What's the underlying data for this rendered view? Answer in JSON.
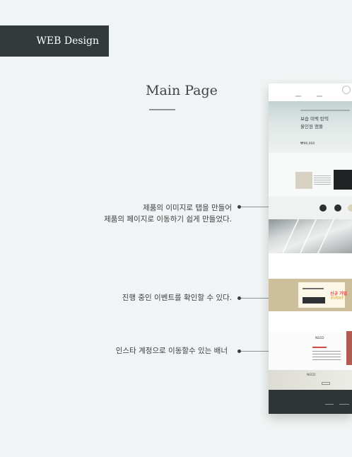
{
  "section_label": "WEB Design",
  "page_title": "Main Page",
  "annotations": [
    {
      "lines": [
        "제품의 이미지로 탭을 만들어",
        "제품의 페이지로 이동하기 쉽게 만들었다."
      ]
    },
    {
      "lines": [
        "진행 중인 이벤트를 확인할 수 있다."
      ]
    },
    {
      "lines": [
        "인스타 계정으로 이동할수 있는 배너"
      ]
    }
  ],
  "screenshot": {
    "hero_line1": "보습 미백 탄력",
    "hero_line2": "올인원 앰플",
    "hero_price": "₩96,000",
    "event_title": "신규 가입",
    "event_word": "EVENT",
    "insta_brand": "NEED",
    "banner_brand": "NEED"
  },
  "colors": {
    "background": "#f1f4f4",
    "label_bar": "#323a3c",
    "footer": "#2f3536",
    "event_accent": "#e0443f"
  }
}
